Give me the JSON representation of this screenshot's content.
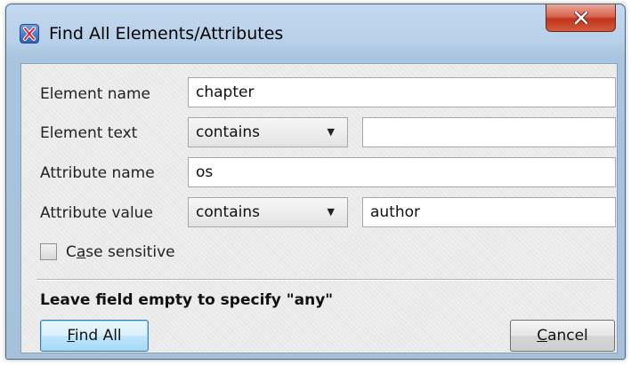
{
  "window": {
    "title": "Find All Elements/Attributes",
    "icon": "xml-editor-x-icon",
    "close_icon": "close-x-icon"
  },
  "form": {
    "element_name": {
      "label": "Element name",
      "value": "chapter"
    },
    "element_text": {
      "label": "Element text",
      "operator": "contains",
      "value": ""
    },
    "attribute_name": {
      "label": "Attribute name",
      "value": "os"
    },
    "attribute_value": {
      "label": "Attribute value",
      "operator": "contains",
      "value": "author"
    },
    "case_sensitive": {
      "label_prefix": "C",
      "label_mnemonic": "a",
      "label_suffix": "se sensitive",
      "checked": false
    }
  },
  "hint": "Leave field empty to specify \"any\"",
  "buttons": {
    "find_all": {
      "mnemonic": "F",
      "rest": "ind All"
    },
    "cancel": {
      "mnemonic": "C",
      "rest": "ancel"
    }
  }
}
